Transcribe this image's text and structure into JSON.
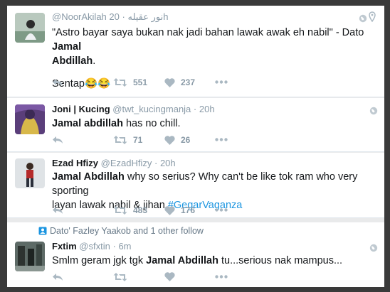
{
  "tweets": [
    {
      "display_name": "@NoorAkilah نور عقيله",
      "handle": "",
      "time": "20h",
      "text_line1_a": "\"Astro bayar saya bukan nak jadi bahan lawak awak eh nabil\" - Dato ",
      "text_line1_b": "Jamal",
      "text_line2_b": "Abdillah",
      "text_line2_c": ".",
      "text_line3": "Sentap😂😂",
      "retweets": "551",
      "likes": "237"
    },
    {
      "display_name": "Joni | Kucing",
      "handle": "@twt_kucingmanja",
      "time": "20h",
      "text_b": "Jamal abdillah",
      "text_c": " has no chill.",
      "retweets": "71",
      "likes": "26"
    },
    {
      "display_name": "Ezad Hfizy",
      "handle": "@EzadHfizy",
      "time": "20h",
      "text_b": "Jamal Abdillah",
      "text_c": " why so serius? Why can't be like tok ram who very sporting",
      "text_line2": "layan lawak nabil & jihan ",
      "hashtag": "#GegarVaganza",
      "retweets": "483",
      "likes": "176"
    },
    {
      "social_context": "Dato' Fazley Yaakob and 1 other follow",
      "display_name": "Fxtim",
      "handle": "@sfxtin",
      "time": "6m",
      "text_a": "Smlm geram jgk tgk ",
      "text_b": "Jamal Abdillah",
      "text_c": " tu...serious nak mampus..."
    }
  ],
  "dot_separator": "·",
  "colors": {
    "accent": "#1b95e0",
    "muted": "#8899a6",
    "text": "#14171a"
  },
  "icons": [
    "reply-icon",
    "retweet-icon",
    "like-icon",
    "more-icon",
    "globe-icon",
    "location-icon",
    "follow-icon"
  ]
}
